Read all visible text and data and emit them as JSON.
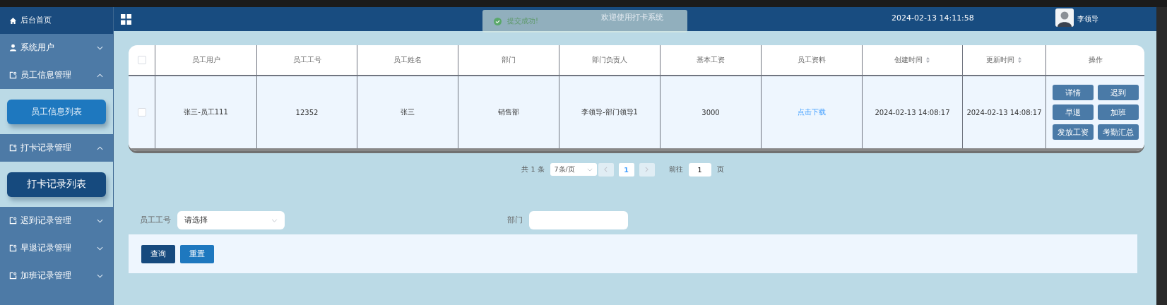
{
  "sidebar": {
    "items": [
      {
        "kind": "home",
        "label": "后台首页"
      },
      {
        "kind": "user",
        "label": "系统用户",
        "expanded": false
      },
      {
        "kind": "group",
        "label": "员工信息管理",
        "expanded": true,
        "children": [
          {
            "label": "员工信息列表",
            "selected": false
          }
        ]
      },
      {
        "kind": "group",
        "label": "打卡记录管理",
        "expanded": true,
        "children": [
          {
            "label": "打卡记录列表",
            "selected": true
          }
        ]
      },
      {
        "kind": "group",
        "label": "迟到记录管理",
        "expanded": false
      },
      {
        "kind": "group",
        "label": "早退记录管理",
        "expanded": false
      },
      {
        "kind": "group",
        "label": "加班记录管理",
        "expanded": false
      }
    ]
  },
  "header": {
    "title": "欢迎使用打卡系统",
    "datetime": "2024-02-13 14:11:58",
    "user_name": "李领导"
  },
  "toast": {
    "message": "提交成功!"
  },
  "table": {
    "all_checked": false,
    "columns": [
      {
        "label": "员工用户",
        "sortable": false
      },
      {
        "label": "员工工号",
        "sortable": false
      },
      {
        "label": "员工姓名",
        "sortable": false
      },
      {
        "label": "部门",
        "sortable": false
      },
      {
        "label": "部门负责人",
        "sortable": false
      },
      {
        "label": "基本工资",
        "sortable": false
      },
      {
        "label": "员工资料",
        "sortable": false
      },
      {
        "label": "创建时间",
        "sortable": true
      },
      {
        "label": "更新时间",
        "sortable": true
      },
      {
        "label": "操作",
        "sortable": false
      }
    ],
    "rows": [
      {
        "checked": false,
        "cells": [
          {
            "kind": "text",
            "text": "张三-员工111"
          },
          {
            "kind": "text",
            "text": "12352"
          },
          {
            "kind": "text",
            "text": "张三"
          },
          {
            "kind": "text",
            "text": "销售部"
          },
          {
            "kind": "text",
            "text": "李领导-部门领导1"
          },
          {
            "kind": "text",
            "text": "3000"
          },
          {
            "kind": "link",
            "text": "点击下载"
          },
          {
            "kind": "text",
            "text": "2024-02-13 14:08:17"
          },
          {
            "kind": "text",
            "text": "2024-02-13 14:08:17"
          }
        ],
        "actions": [
          "详情",
          "迟到",
          "早退",
          "加班",
          "发放工资",
          "考勤汇总"
        ]
      }
    ]
  },
  "pagination": {
    "total": "共 1 条",
    "page_size": "7条/页",
    "pages": [
      {
        "label": "1",
        "selected": true
      }
    ],
    "goto_label": "前往",
    "goto_value": "1",
    "suffix": "页"
  },
  "filters": [
    {
      "kind": "select",
      "label": "员工工号",
      "placeholder": "请选择"
    },
    {
      "kind": "input",
      "label": "部门"
    }
  ],
  "buttons": [
    {
      "kind": "primary",
      "label": "查询"
    },
    {
      "kind": "secondary",
      "label": "重置"
    }
  ]
}
